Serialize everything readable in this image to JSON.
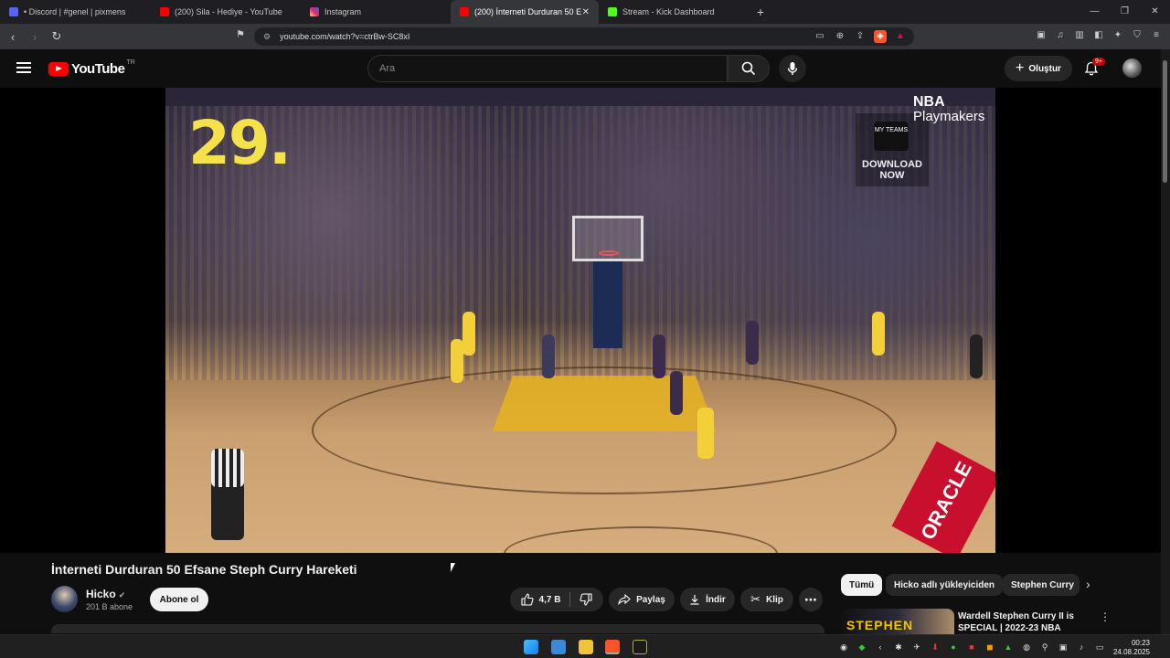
{
  "browser": {
    "tabs": [
      {
        "title": "• Discord | #genel | pixmens",
        "color": "#5865f2"
      },
      {
        "title": "(200) Sila - Hediye - YouTube",
        "color": "#ff0000"
      },
      {
        "title": "Instagram",
        "color": "#e1306c"
      },
      {
        "title": "(200) İnterneti Durduran 50 E",
        "color": "#ff0000",
        "active": true
      },
      {
        "title": "Stream - Kick Dashboard",
        "color": "#53fc18"
      }
    ],
    "new_tab": "+",
    "url": "youtube.com/watch?v=ctrBw-SC8xI"
  },
  "youtube": {
    "logo_text": "YouTube",
    "country": "TR",
    "search_placeholder": "Ara",
    "create_label": "Oluştur",
    "notif_count": "9+"
  },
  "video": {
    "overlay_number": "29.",
    "nba_line1": "NBA",
    "nba_line2": "Playmakers",
    "myteams": "MY TEAMS",
    "download_line1": "DOWNLOAD",
    "download_line2": "NOW",
    "sponsor": "ORACLE"
  },
  "meta": {
    "title": "İnterneti Durduran 50 Efsane Steph Curry Hareketi",
    "channel": "Hicko",
    "subs": "201 B abone",
    "subscribe": "Abone ol",
    "likes": "4,7 B",
    "share": "Paylaş",
    "download": "İndir",
    "clip": "Klip",
    "more": "⋯"
  },
  "sidebar": {
    "chips": [
      "Tümü",
      "Hicko adlı yükleyiciden",
      "Stephen Curry"
    ],
    "rec_title": "Wardell Stephen Curry II is SPECIAL | 2022-23 NBA",
    "rec_thumb_text": "STEPHEN"
  },
  "taskbar": {
    "time": "00:23",
    "date": "24.08.2025"
  }
}
